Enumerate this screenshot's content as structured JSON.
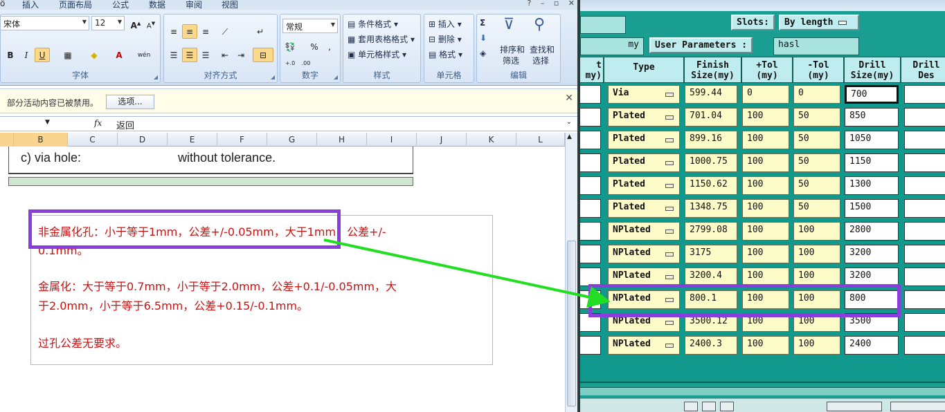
{
  "excel": {
    "tabs": [
      "插入",
      "页面布局",
      "公式",
      "数据",
      "审阅",
      "视图"
    ],
    "font": {
      "name": "宋体",
      "size": "12",
      "group_label": "字体"
    },
    "alignment": {
      "group_label": "对齐方式"
    },
    "number": {
      "format": "常规",
      "percent": "%",
      "comma": ",",
      "group_label": "数字"
    },
    "styles": {
      "conditional": "条件格式",
      "table_format": "套用表格格式",
      "cell_styles": "单元格样式",
      "group_label": "样式"
    },
    "cells": {
      "insert": "插入",
      "delete": "删除",
      "format": "格式",
      "group_label": "单元格"
    },
    "editing": {
      "sigma": "Σ",
      "sort_filter_1": "排序和",
      "sort_filter_2": "筛选",
      "find_1": "查找和",
      "find_2": "选择",
      "group_label": "编辑"
    },
    "security_bar": {
      "message": "部分活动内容已被禁用。",
      "options_button": "选项..."
    },
    "formula_bar": {
      "fx": "fx",
      "value": "返回"
    },
    "columns": [
      "B",
      "C",
      "D",
      "E",
      "F",
      "G",
      "H",
      "I",
      "J",
      "K",
      "L"
    ],
    "sheet": {
      "via_label": "c) via hole:",
      "via_tolerance": "without tolerance."
    },
    "note": {
      "line1": "非金属化孔：小于等于1mm，公差+/-0.05mm，大于1mm，公差+/-",
      "line2": "0.1mm。",
      "line3": "金属化：大于等于0.7mm，小于等于2.0mm，公差+0.1/-0.05mm，大",
      "line4": "于2.0mm，小于等于6.5mm，公差+0.15/-0.1mm。",
      "line5": "过孔公差无要求。"
    }
  },
  "cam": {
    "top": {
      "unit": "my",
      "slots_label": "Slots:",
      "slots_value": "By length",
      "user_params": "User Parameters :",
      "finish_value": "hasl"
    },
    "headers": {
      "first_partial_1": "t",
      "first_partial_2": "my)",
      "type": "Type",
      "finish_1": "Finish",
      "finish_2": "Size(my)",
      "plus_1": "+Tol",
      "plus_2": "(my)",
      "minus_1": "-Tol",
      "minus_2": "(my)",
      "drill_1": "Drill",
      "drill_2": "Size(my)",
      "des_1": "Drill",
      "des_2": "Des"
    },
    "rows": [
      {
        "type": "Via",
        "finish": "599.44",
        "plus": "0",
        "minus": "0",
        "drill": "700"
      },
      {
        "type": "Plated",
        "finish": "701.04",
        "plus": "100",
        "minus": "50",
        "drill": "850"
      },
      {
        "type": "Plated",
        "finish": "899.16",
        "plus": "100",
        "minus": "50",
        "drill": "1050"
      },
      {
        "type": "Plated",
        "finish": "1000.75",
        "plus": "100",
        "minus": "50",
        "drill": "1150"
      },
      {
        "type": "Plated",
        "finish": "1150.62",
        "plus": "100",
        "minus": "50",
        "drill": "1300"
      },
      {
        "type": "Plated",
        "finish": "1348.75",
        "plus": "100",
        "minus": "50",
        "drill": "1500"
      },
      {
        "type": "NPlated",
        "finish": "2799.08",
        "plus": "100",
        "minus": "100",
        "drill": "2800"
      },
      {
        "type": "NPlated",
        "finish": "3175",
        "plus": "100",
        "minus": "100",
        "drill": "3200"
      },
      {
        "type": "NPlated",
        "finish": "3200.4",
        "plus": "100",
        "minus": "100",
        "drill": "3200"
      },
      {
        "type": "NPlated",
        "finish": "800.1",
        "plus": "100",
        "minus": "100",
        "drill": "800"
      },
      {
        "type": "NPlated",
        "finish": "3500.12",
        "plus": "100",
        "minus": "100",
        "drill": "3500"
      },
      {
        "type": "NPlated",
        "finish": "2400.3",
        "plus": "100",
        "minus": "100",
        "drill": "2400"
      }
    ]
  },
  "colors": {
    "highlight": "#8a3cdc",
    "arrow": "#22dd22",
    "note_text": "#cc1111",
    "cam_bg": "#12998d",
    "cell_yellow": "#fdfbc8"
  }
}
